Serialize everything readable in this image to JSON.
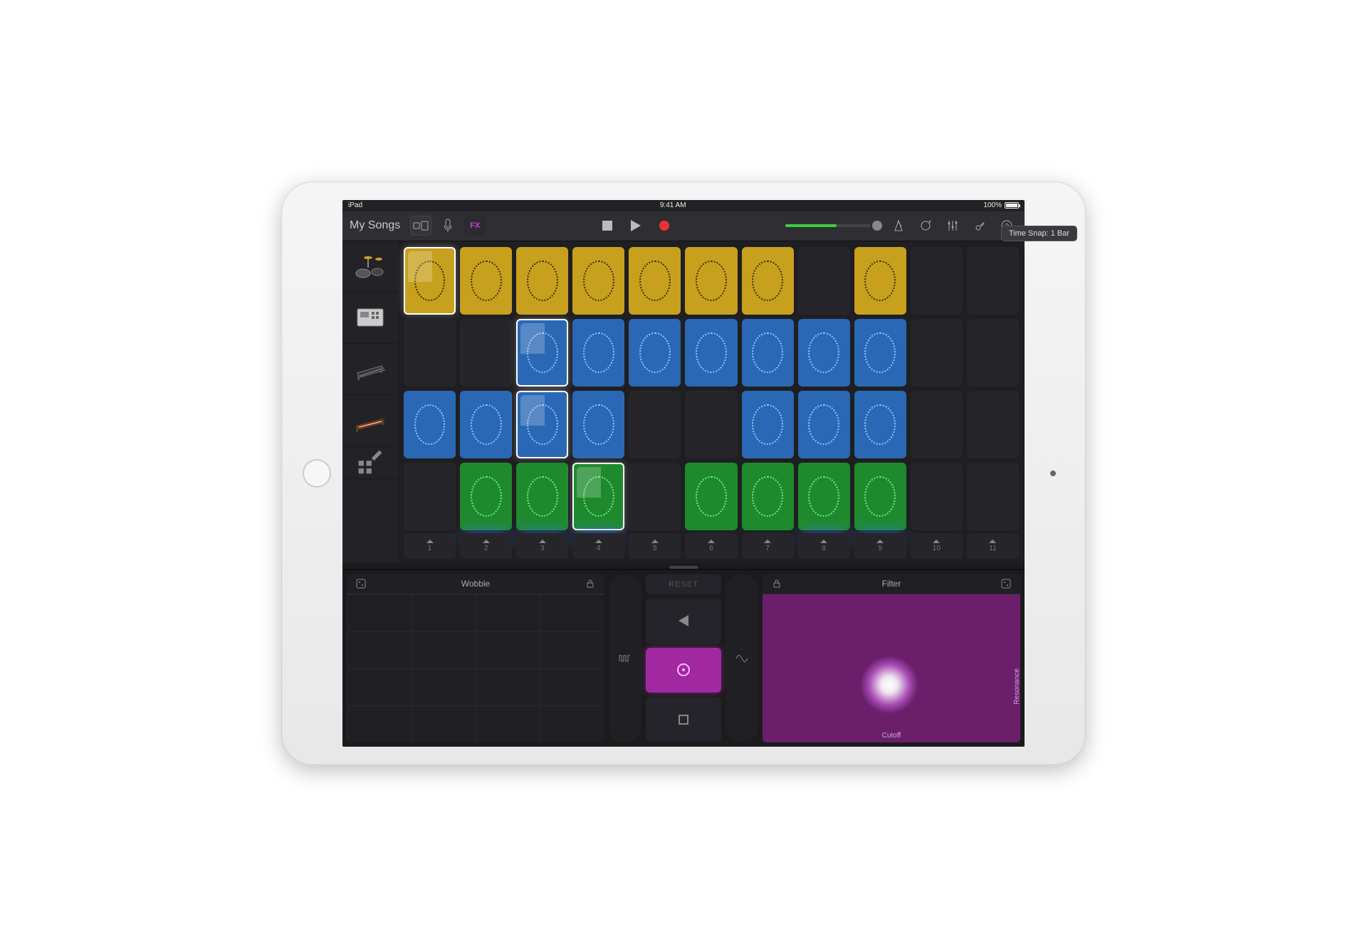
{
  "statusbar": {
    "device": "iPad",
    "time": "9:41 AM",
    "battery": "100%"
  },
  "toolbar": {
    "back_label": "My Songs",
    "fx_label": "FX"
  },
  "timesnap": "Time Snap: 1 Bar",
  "tracks": [
    {
      "name": "drums"
    },
    {
      "name": "sampler"
    },
    {
      "name": "keys"
    },
    {
      "name": "synth"
    }
  ],
  "columns": [
    "1",
    "2",
    "3",
    "4",
    "5",
    "6",
    "7",
    "8",
    "9",
    "10",
    "11"
  ],
  "active_columns": [
    2,
    3,
    4,
    8,
    9
  ],
  "grid": [
    [
      "yellow-active",
      "yellow",
      "yellow",
      "yellow",
      "yellow",
      "yellow",
      "yellow",
      "",
      "yellow",
      "",
      ""
    ],
    [
      "",
      "",
      "blue-active",
      "blue",
      "blue",
      "blue",
      "blue",
      "blue",
      "blue",
      "",
      ""
    ],
    [
      "blue",
      "blue",
      "blue-active",
      "blue",
      "",
      "",
      "blue",
      "blue",
      "blue",
      "",
      ""
    ],
    [
      "",
      "green",
      "green",
      "green-active",
      "",
      "green",
      "green",
      "green",
      "green",
      "",
      ""
    ]
  ],
  "fx": {
    "left": {
      "label": "Wobble"
    },
    "right": {
      "label": "Filter",
      "x_axis": "Cutoff",
      "y_axis": "Resonance"
    },
    "reset_label": "RESET"
  }
}
